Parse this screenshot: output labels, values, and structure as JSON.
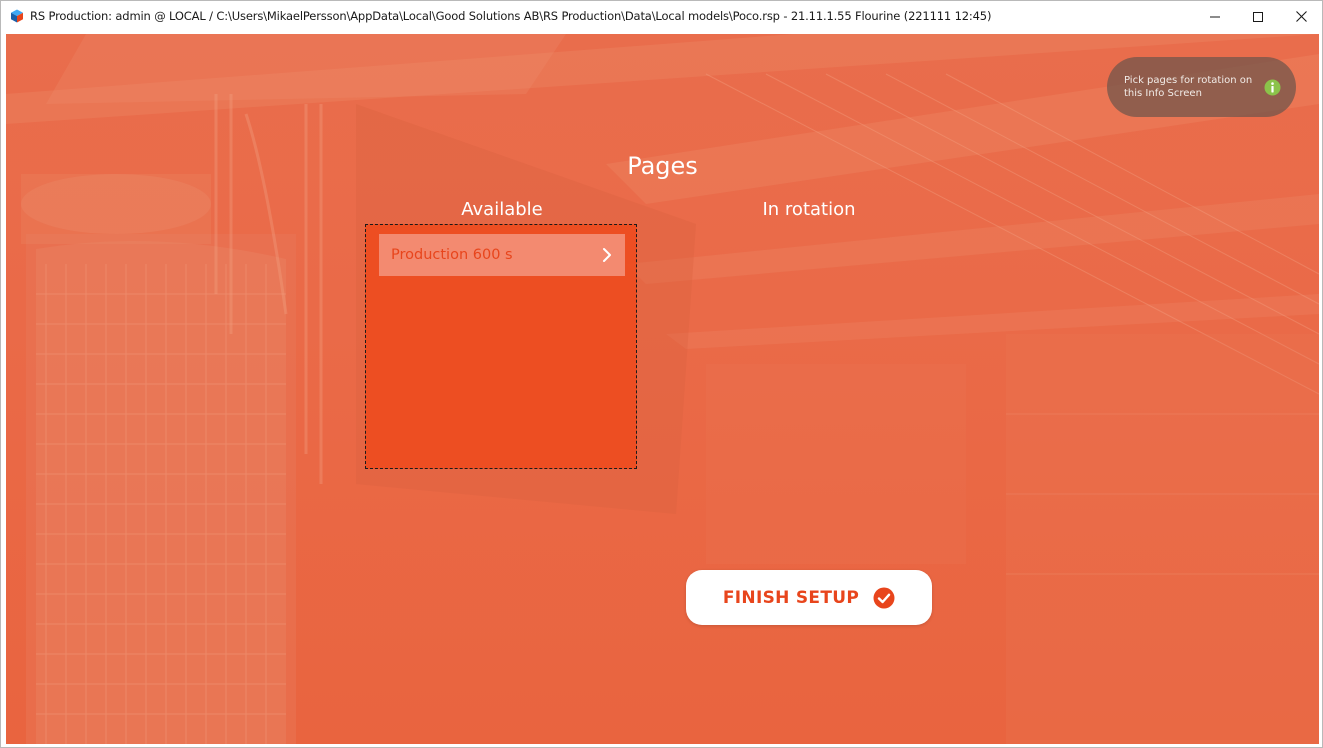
{
  "window": {
    "title": "RS Production: admin @ LOCAL / C:\\Users\\MikaelPersson\\AppData\\Local\\Good Solutions AB\\RS Production\\Data\\Local models\\Poco.rsp - 21.11.1.55 Flourine (221111 12:45)",
    "icon": "rs-production-app-icon"
  },
  "colors": {
    "accent": "#e8451c",
    "background": "#ea6a48",
    "info_success": "#8bc34a"
  },
  "pages": {
    "heading": "Pages",
    "available_label": "Available",
    "rotation_label": "In rotation",
    "available_items": [
      {
        "label": "Production 600 s",
        "icon": "chevron-right-icon"
      }
    ]
  },
  "info": {
    "text": "Pick pages for rotation on this Info Screen",
    "icon": "info-icon"
  },
  "finish": {
    "label": "FINISH SETUP",
    "icon": "check-circle-icon"
  }
}
